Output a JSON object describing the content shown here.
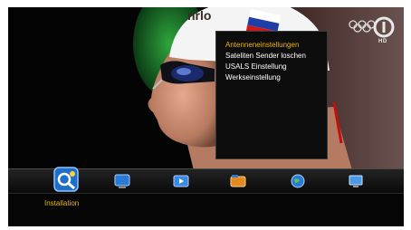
{
  "menu": {
    "items": [
      {
        "label": "Antenneneinstellungen",
        "active": true
      },
      {
        "label": "Sateliten Sender loschen",
        "active": false
      },
      {
        "label": "USALS Einstellung",
        "active": false
      },
      {
        "label": "Werkseinstellung",
        "active": false
      }
    ]
  },
  "iconbar": {
    "selected_label": "Installation",
    "icons": [
      {
        "name": "installation-icon",
        "selected": true
      },
      {
        "name": "tv-icon",
        "selected": false
      },
      {
        "name": "media-icon",
        "selected": false
      },
      {
        "name": "folder-icon",
        "selected": false
      },
      {
        "name": "globe-icon",
        "selected": false
      },
      {
        "name": "monitor-icon",
        "selected": false
      }
    ]
  },
  "background": {
    "flag_colors": [
      "#ffffff",
      "#1f3fa8",
      "#d01818"
    ],
    "cap_text": "nrlo"
  },
  "channel": {
    "hd_badge": "HD"
  },
  "colors": {
    "highlight": "#f0b400",
    "menu_text": "#ffffff",
    "menu_bg": "#0d0d0d"
  }
}
